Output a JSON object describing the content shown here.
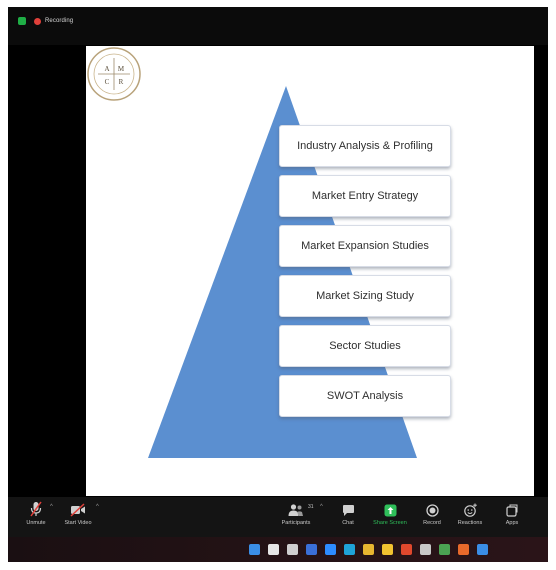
{
  "recording": {
    "label": "Recording",
    "shield_color": "#1fae46",
    "dot_color": "#e0403a"
  },
  "slide": {
    "pyramid_color": "#5b8fd0",
    "boxes": [
      "Industry Analysis & Profiling",
      "Market Entry Strategy",
      "Market Expansion Studies",
      "Market Sizing Study",
      "Sector Studies",
      "SWOT Analysis"
    ],
    "logo": {
      "icon": "company-seal-logo",
      "letters": [
        "A",
        "M",
        "C",
        "R"
      ]
    }
  },
  "toolbar": {
    "unmute": {
      "label": "Unmute",
      "icon": "microphone-muted-icon"
    },
    "start_video": {
      "label": "Start Video",
      "icon": "video-camera-off-icon"
    },
    "participants": {
      "label": "Participants",
      "count": "31",
      "icon": "participants-icon"
    },
    "chat": {
      "label": "Chat",
      "icon": "chat-bubble-icon"
    },
    "share_screen": {
      "label": "Share Screen",
      "icon": "share-screen-icon",
      "color": "#2fbf5a"
    },
    "record": {
      "label": "Record",
      "icon": "record-icon"
    },
    "reactions": {
      "label": "Reactions",
      "icon": "reactions-icon"
    },
    "apps": {
      "label": "Apps",
      "icon": "apps-icon"
    }
  },
  "taskbar": {
    "icons": [
      {
        "name": "windows-start-icon",
        "color": "#3a8ee6"
      },
      {
        "name": "search-icon",
        "color": "#e6e6e6"
      },
      {
        "name": "task-view-icon",
        "color": "#cfcfcf"
      },
      {
        "name": "widgets-icon",
        "color": "#3a6fd8"
      },
      {
        "name": "zoom-icon",
        "color": "#2d8cff"
      },
      {
        "name": "edge-browser-icon",
        "color": "#1fa3d8"
      },
      {
        "name": "file-explorer-icon",
        "color": "#e8b630"
      },
      {
        "name": "winamp-icon",
        "color": "#f2c230"
      },
      {
        "name": "office-icon",
        "color": "#e0482d"
      },
      {
        "name": "app-icon",
        "color": "#c8c8c8"
      },
      {
        "name": "chrome-icon",
        "color": "#4ba352"
      },
      {
        "name": "firefox-icon",
        "color": "#e86a2b"
      },
      {
        "name": "document-icon",
        "color": "#3a8ee6"
      }
    ]
  }
}
